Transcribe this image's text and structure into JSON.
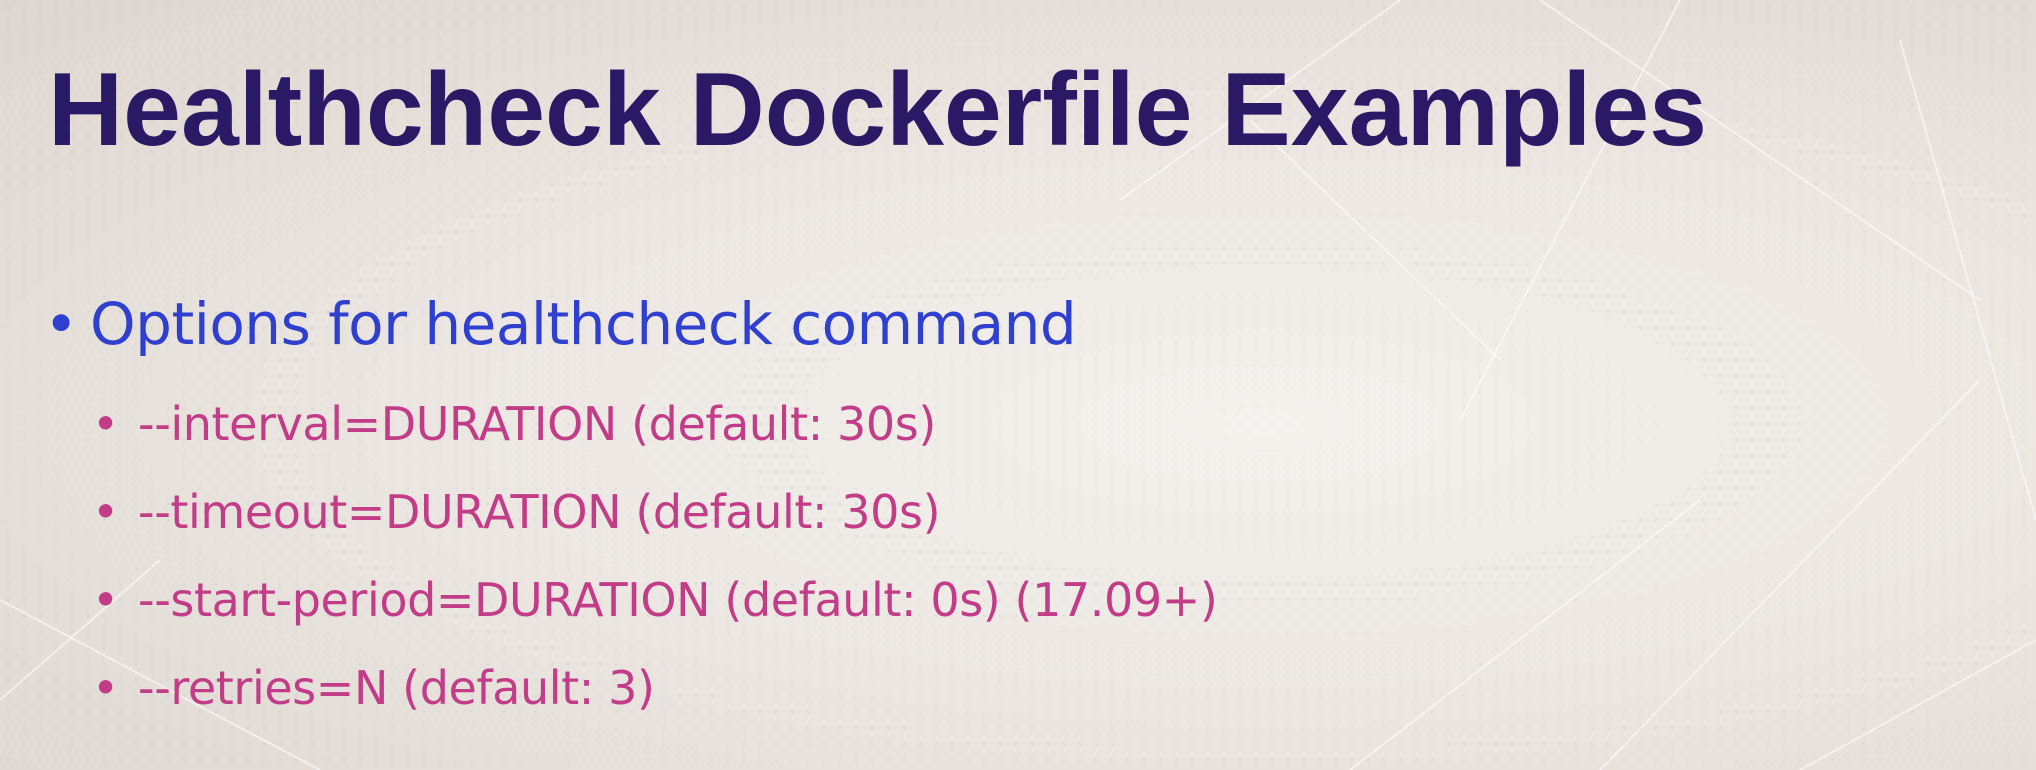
{
  "slide": {
    "title": "Healthcheck Dockerfile Examples",
    "bullet": {
      "marker": "•",
      "text": "Options for healthcheck command",
      "sub_items": [
        {
          "marker": "•",
          "text": "--interval=DURATION (default: 30s)"
        },
        {
          "marker": "•",
          "text": "--timeout=DURATION (default: 30s)"
        },
        {
          "marker": "•",
          "text": "--start-period=DURATION (default: 0s) (17.09+)"
        },
        {
          "marker": "•",
          "text": "--retries=N (default: 3)"
        }
      ]
    },
    "colors": {
      "title": "#2a1a66",
      "level1": "#2f3fd0",
      "level2": "#c23c88",
      "background": "#ece7e2"
    }
  }
}
